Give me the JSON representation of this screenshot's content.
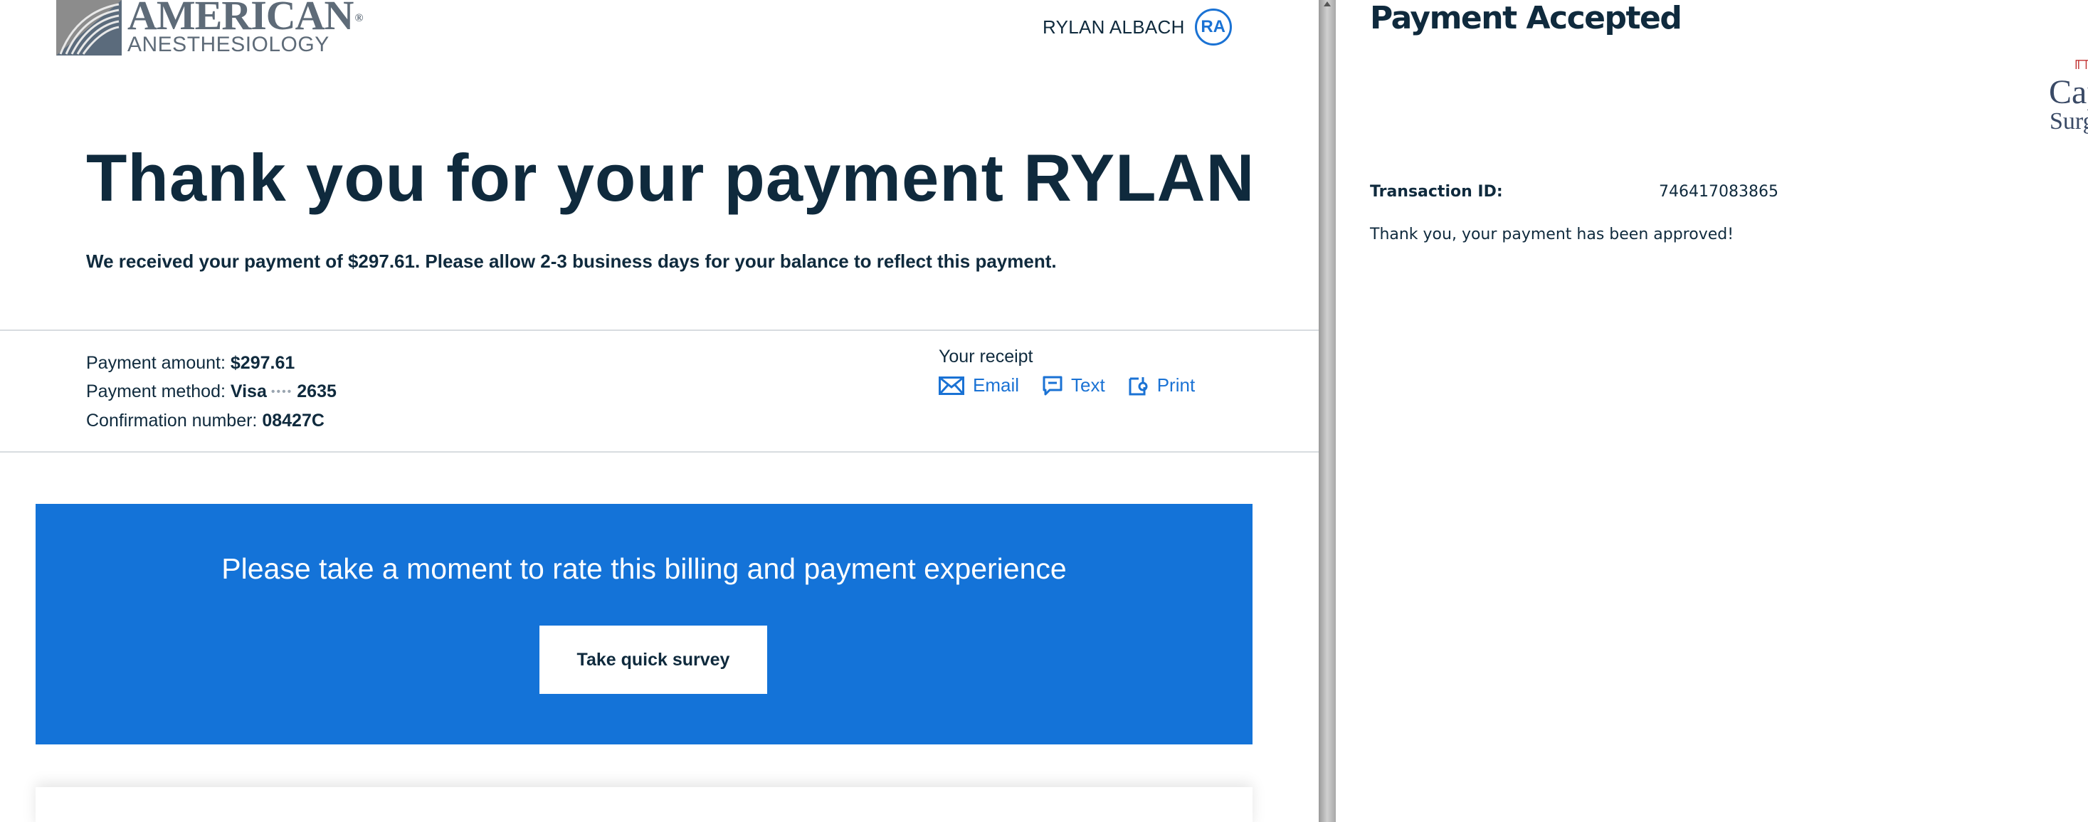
{
  "brand": {
    "name_line1": "AMERICAN",
    "registered": "®",
    "name_line2": "ANESTHESIOLOGY"
  },
  "user": {
    "name": "RYLAN ALBACH",
    "initials": "RA"
  },
  "main": {
    "heading": "Thank you for your payment RYLAN",
    "message": "We received your payment of $297.61. Please allow 2-3 business days for your balance to reflect this payment."
  },
  "payment": {
    "amount_label": "Payment amount:",
    "amount_value": "$297.61",
    "method_label": "Payment method:",
    "method_brand": "Visa",
    "method_mask": "••••",
    "method_last4": "2635",
    "confirmation_label": "Confirmation number:",
    "confirmation_value": "08427C"
  },
  "receipt": {
    "title": "Your receipt",
    "email": "Email",
    "text": "Text",
    "print": "Print"
  },
  "survey": {
    "prompt": "Please take a moment to rate this billing and payment experience",
    "button": "Take quick survey"
  },
  "side_panel": {
    "title": "Payment Accepted",
    "transaction_label": "Transaction ID:",
    "transaction_value": "746417083865",
    "approved_message": "Thank you, your payment has been approved!",
    "logo_line1": "Cap",
    "logo_line2": "Surg"
  },
  "colors": {
    "accent": "#1a72d4",
    "banner": "#1473d8",
    "navy": "#0f2a3d",
    "logo_gray": "#5e6b78"
  }
}
